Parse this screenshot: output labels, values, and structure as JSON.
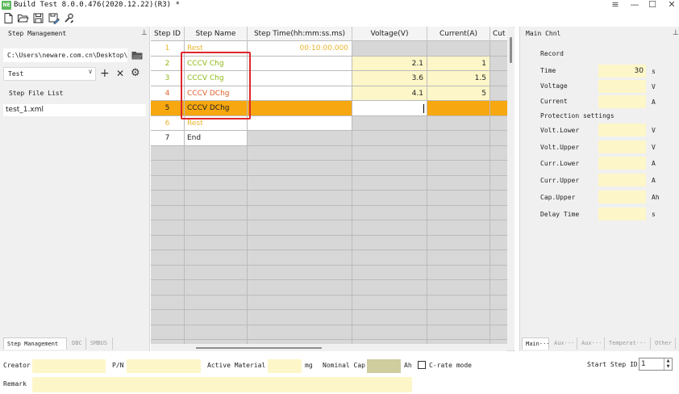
{
  "window": {
    "logo": "NE",
    "title": "Build Test 8.0.0.476(2020.12.22)(R3) *",
    "controls": {
      "menu": "≡",
      "minimize": "—",
      "maximize": "☐",
      "close": "✕"
    }
  },
  "toolbar": {
    "icons": [
      "new-file-icon",
      "open-folder-icon",
      "save-icon",
      "save-as-icon",
      "tools-icon"
    ]
  },
  "left_panel": {
    "title": "Step Management",
    "pin": "⊥",
    "path": "C:\\Users\\neware.com.cn\\Desktop\\",
    "combo_value": "Test",
    "add": "+",
    "remove": "✕",
    "settings": "⚙",
    "file_list_label": "Step File List",
    "files": [
      "test_1.xml"
    ],
    "tabs": [
      "Step Management",
      "DBC",
      "SMBUS"
    ]
  },
  "grid": {
    "columns": [
      "Step ID",
      "Step Name",
      "Step Time(hh:mm:ss.ms)",
      "Voltage(V)",
      "Current(A)",
      "Cut"
    ],
    "rows": [
      {
        "id": "1",
        "name": "Rest",
        "time": "00:10:00.000",
        "voltage": "",
        "current": "",
        "color": "#e8b42a"
      },
      {
        "id": "2",
        "name": "CCCV Chg",
        "time": "",
        "voltage": "2.1",
        "current": "1",
        "color": "#8cba14"
      },
      {
        "id": "3",
        "name": "CCCV Chg",
        "time": "",
        "voltage": "3.6",
        "current": "1.5",
        "color": "#8cba14"
      },
      {
        "id": "4",
        "name": "CCCV DChg",
        "time": "",
        "voltage": "4.1",
        "current": "5",
        "color": "#e0602a"
      },
      {
        "id": "5",
        "name": "CCCV DChg",
        "time": "",
        "voltage": "",
        "current": "",
        "color": "#222222"
      },
      {
        "id": "6",
        "name": "Rest",
        "time": "",
        "voltage": "",
        "current": "",
        "color": "#e8b42a"
      },
      {
        "id": "7",
        "name": "End",
        "time": "",
        "voltage": "",
        "current": "",
        "color": "#222222"
      }
    ],
    "selected_row": "5",
    "selection_color": "#f7a70f",
    "highlight_color": "#e0262c"
  },
  "right_panel": {
    "title": "Main Chnl",
    "record_label": "Record",
    "fields": [
      {
        "label": "Time",
        "value": "30",
        "unit": "s"
      },
      {
        "label": "Voltage",
        "value": "",
        "unit": "V"
      },
      {
        "label": "Current",
        "value": "",
        "unit": "A"
      }
    ],
    "protection_label": "Protection settings",
    "protection": [
      {
        "label": "Volt.Lower",
        "value": "",
        "unit": "V"
      },
      {
        "label": "Volt.Upper",
        "value": "",
        "unit": "V"
      },
      {
        "label": "Curr.Lower",
        "value": "",
        "unit": "A"
      },
      {
        "label": "Curr.Upper",
        "value": "",
        "unit": "A"
      },
      {
        "label": "Cap.Upper",
        "value": "",
        "unit": "Ah"
      },
      {
        "label": "Delay Time",
        "value": "",
        "unit": "s"
      }
    ],
    "tabs": [
      "Main···",
      "Aux···",
      "Aux···",
      "Temperat···",
      "Other"
    ]
  },
  "footer": {
    "creator_label": "Creator",
    "pn_label": "P/N",
    "active_material_label": "Active Material",
    "mg_unit": "mg",
    "nominal_cap_label": "Nominal Cap",
    "ah_unit": "Ah",
    "crate_label": "C-rate mode",
    "start_step_label": "Start Step ID",
    "start_step_value": "1",
    "remark_label": "Remark"
  }
}
